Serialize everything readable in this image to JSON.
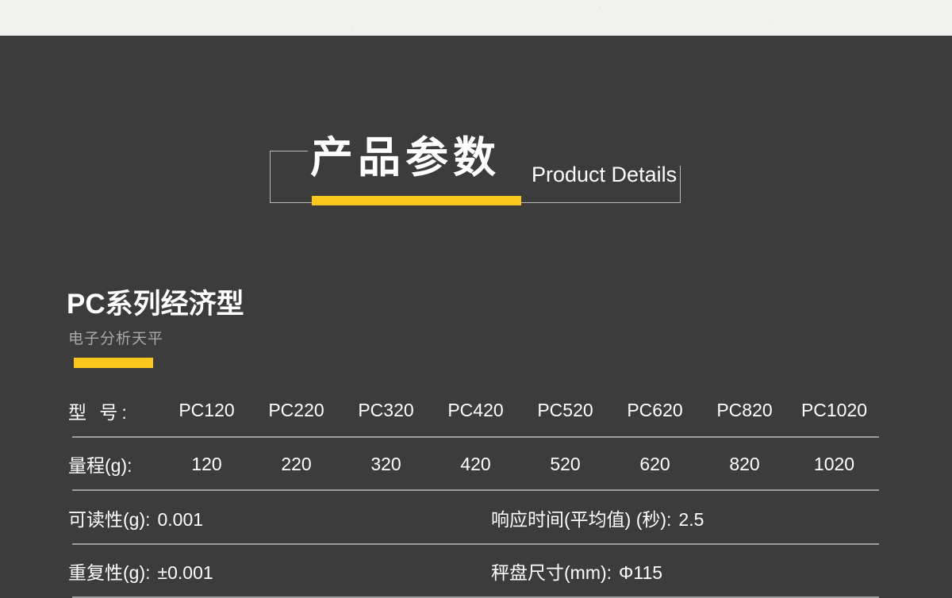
{
  "banner": {
    "title_cn": "产品参数",
    "title_en": "Product Details"
  },
  "product": {
    "title": "PC系列经济型",
    "subtitle": "电子分析天平"
  },
  "colors": {
    "background": "#3c3c3c",
    "paper": "#f1f1f0",
    "accent_yellow": "#fbc71f",
    "divider": "#9d9d9d",
    "text_primary": "#ffffff",
    "text_secondary": "#a9a9a9"
  },
  "spec_table": {
    "rows": [
      {
        "type": "grid",
        "label": "型 号:",
        "cells": [
          "PC120",
          "PC220",
          "PC320",
          "PC420",
          "PC520",
          "PC620",
          "PC820",
          "PC1020"
        ]
      },
      {
        "type": "grid",
        "label": "量程(g):",
        "cells": [
          "120",
          "220",
          "320",
          "420",
          "520",
          "620",
          "820",
          "1020"
        ]
      },
      {
        "type": "pair",
        "left_key": "可读性(g):",
        "left_value": "0.001",
        "right_key": "响应时间(平均值) (秒):",
        "right_value": "2.5"
      },
      {
        "type": "pair",
        "left_key": "重复性(g):",
        "left_value": "±0.001",
        "right_key": "秤盘尺寸(mm):",
        "right_value": "Φ115"
      }
    ]
  }
}
